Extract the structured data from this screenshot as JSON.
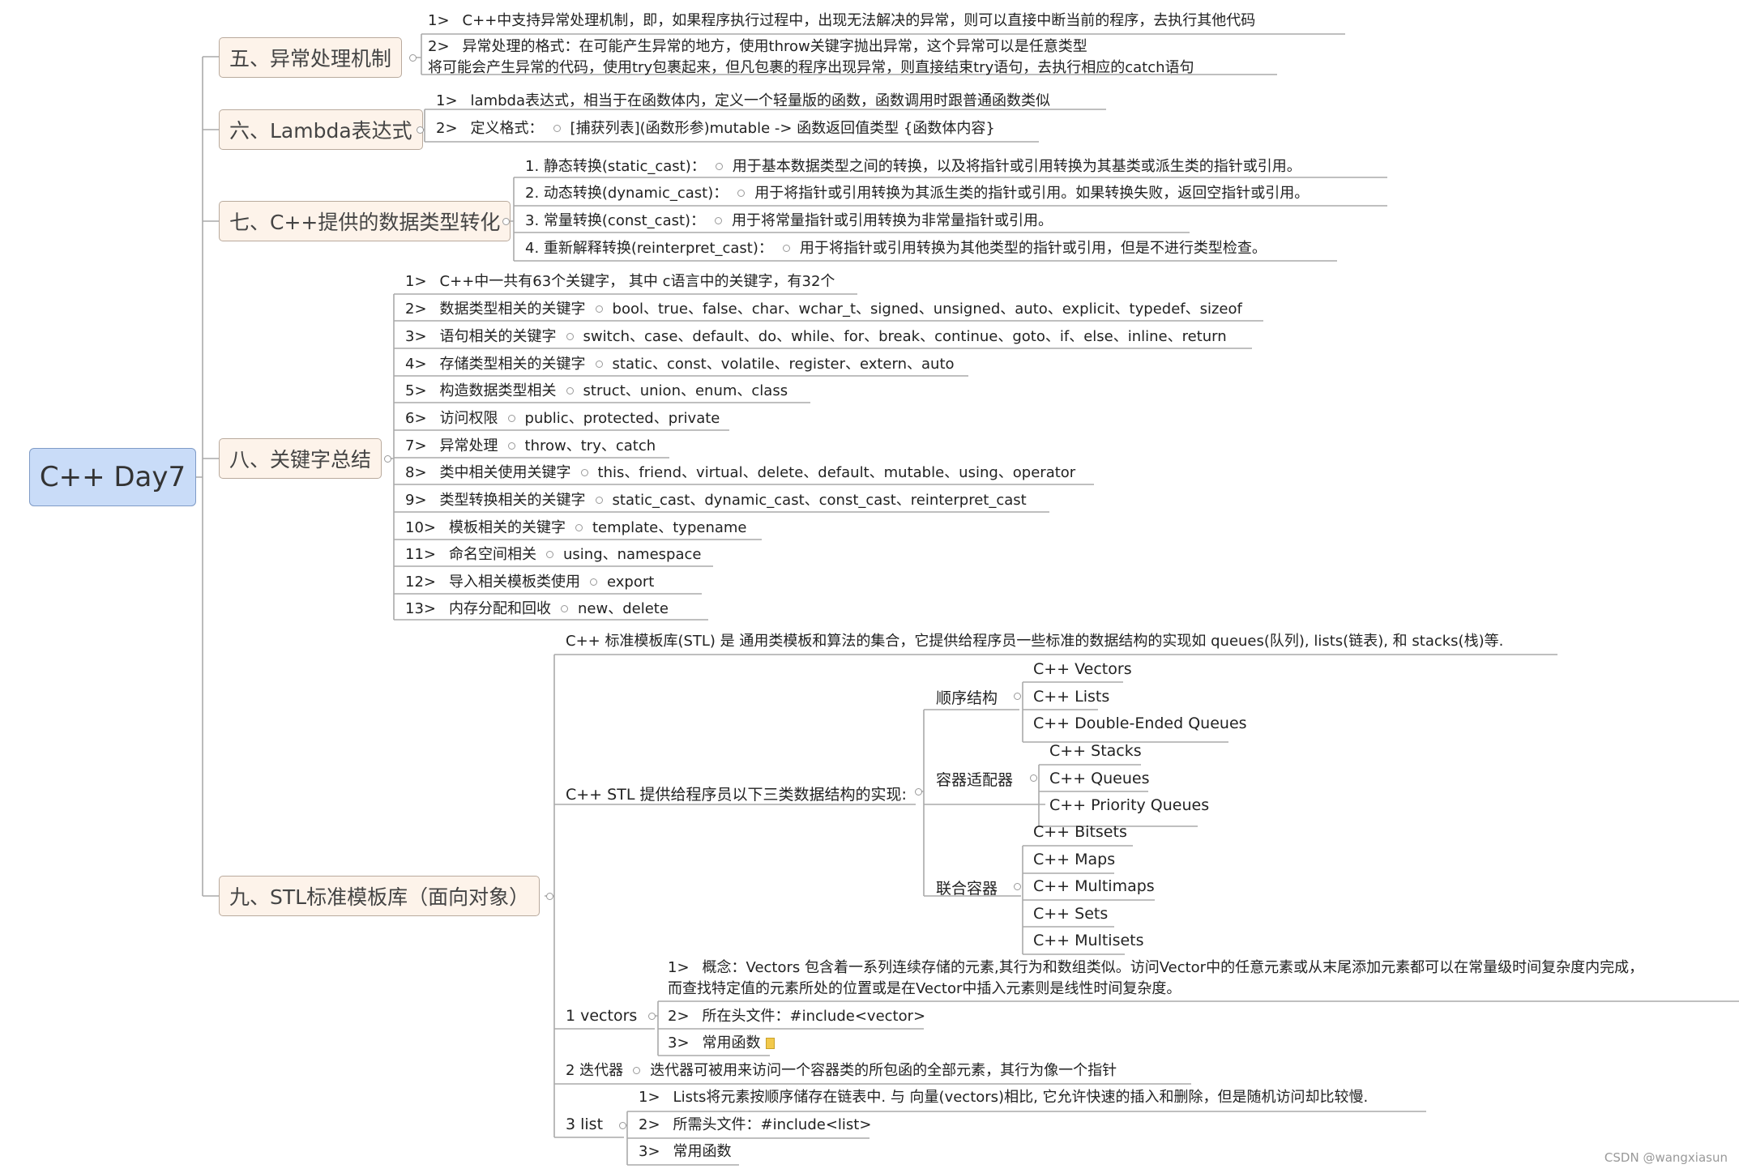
{
  "root": {
    "label": "C++ Day7"
  },
  "topics": [
    {
      "id": "t5",
      "label": "五、异常处理机制",
      "items": [
        {
          "num": "1>",
          "text": "C++中支持异常处理机制，即，如果程序执行过程中，出现无法解决的异常，则可以直接中断当前的程序，去执行其他代码"
        },
        {
          "num": "2>",
          "text": "异常处理的格式：在可能产生异常的地方，使用throw关键字抛出异常，这个异常可以是任意类型",
          "text2": "将可能会产生异常的代码，使用try包裹起来，但凡包裹的程序出现异常，则直接结束try语句，去执行相应的catch语句"
        }
      ]
    },
    {
      "id": "t6",
      "label": "六、Lambda表达式",
      "items": [
        {
          "num": "1>",
          "text": "lambda表达式，相当于在函数体内，定义一个轻量版的函数，函数调用时跟普通函数类似"
        },
        {
          "num": "2>",
          "text": "定义格式：",
          "detail": "[捕获列表](函数形参)mutable ->   函数返回值类型 {函数体内容}"
        }
      ]
    },
    {
      "id": "t7",
      "label": "七、C++提供的数据类型转化",
      "items": [
        {
          "text": "1. 静态转换(static_cast)：",
          "detail": "用于基本数据类型之间的转换，以及将指针或引用转换为其基类或派生类的指针或引用。"
        },
        {
          "text": "2. 动态转换(dynamic_cast)：",
          "detail": "用于将指针或引用转换为其派生类的指针或引用。如果转换失败，返回空指针或引用。"
        },
        {
          "text": "3. 常量转换(const_cast)：",
          "detail": "用于将常量指针或引用转换为非常量指针或引用。"
        },
        {
          "text": "4. 重新解释转换(reinterpret_cast)：",
          "detail": "用于将指针或引用转换为其他类型的指针或引用，但是不进行类型检查。"
        }
      ]
    },
    {
      "id": "t8",
      "label": "八、关键字总结",
      "items": [
        {
          "num": "1>",
          "text": "C++中一共有63个关键字， 其中 c语言中的关键字，有32个"
        },
        {
          "num": "2>",
          "text": "数据类型相关的关键字",
          "detail": "bool、true、false、char、wchar_t、signed、unsigned、auto、explicit、typedef、sizeof"
        },
        {
          "num": "3>",
          "text": "语句相关的关键字",
          "detail": "switch、case、default、do、while、for、break、continue、goto、if、else、inline、return"
        },
        {
          "num": "4>",
          "text": "存储类型相关的关键字",
          "detail": "static、const、volatile、register、extern、auto"
        },
        {
          "num": "5>",
          "text": "构造数据类型相关",
          "detail": "struct、union、enum、class"
        },
        {
          "num": "6>",
          "text": "访问权限",
          "detail": "public、protected、private"
        },
        {
          "num": "7>",
          "text": "异常处理",
          "detail": "throw、try、catch"
        },
        {
          "num": "8>",
          "text": "类中相关使用关键字",
          "detail": "this、friend、virtual、delete、default、mutable、using、operator"
        },
        {
          "num": "9>",
          "text": "类型转换相关的关键字",
          "detail": "static_cast、dynamic_cast、const_cast、reinterpret_cast"
        },
        {
          "num": "10>",
          "text": "模板相关的关键字",
          "detail": "template、typename"
        },
        {
          "num": "11>",
          "text": "命名空间相关",
          "detail": "using、namespace"
        },
        {
          "num": "12>",
          "text": "导入相关模板类使用",
          "detail": "export"
        },
        {
          "num": "13>",
          "text": "内存分配和回收",
          "detail": "new、delete"
        }
      ]
    },
    {
      "id": "t9",
      "label": "九、STL标准模板库（面向对象）",
      "intro": "C++ 标准模板库(STL) 是 通用类模板和算法的集合，它提供给程序员一些标准的数据结构的实现如 queues(队列), lists(链表), 和 stacks(栈)等.",
      "structures": {
        "label": "C++ STL 提供给程序员以下三类数据结构的实现:",
        "groups": [
          {
            "label": "顺序结构",
            "items": [
              "C++ Vectors",
              "C++ Lists",
              "C++ Double-Ended Queues"
            ]
          },
          {
            "label": "容器适配器",
            "items": [
              "C++ Stacks",
              "C++ Queues",
              "C++ Priority Queues"
            ]
          },
          {
            "label": "联合容器",
            "items": [
              "C++ Bitsets",
              "C++ Maps",
              "C++ Multimaps",
              "C++ Sets",
              "C++ Multisets"
            ]
          }
        ]
      },
      "vectors": {
        "label": "1   vectors",
        "items": [
          {
            "num": "1>",
            "text": "概念：Vectors 包含着一系列连续存储的元素,其行为和数组类似。访问Vector中的任意元素或从末尾添加元素都可以在常量级时间复杂度内完成，",
            "text2": "而查找特定值的元素所处的位置或是在Vector中插入元素则是线性时间复杂度。"
          },
          {
            "num": "2>",
            "text": "所在头文件：#include<vector>"
          },
          {
            "num": "3>",
            "text": "常用函数"
          }
        ]
      },
      "iterator": {
        "label": "2   迭代器",
        "detail": "迭代器可被用来访问一个容器类的所包函的全部元素，其行为像一个指针"
      },
      "list": {
        "label": "3   list",
        "items": [
          {
            "num": "1>",
            "text": "Lists将元素按顺序储存在链表中. 与 向量(vectors)相比, 它允许快速的插入和删除，但是随机访问却比较慢."
          },
          {
            "num": "2>",
            "text": "所需头文件：#include<list>"
          },
          {
            "num": "3>",
            "text": "常用函数"
          }
        ]
      }
    }
  ],
  "watermark": "CSDN @wangxiasun",
  "colors": {
    "root_fill": "#c9dcf8",
    "topic_fill": "#fdf3ea",
    "line": "#aaaaaa"
  }
}
